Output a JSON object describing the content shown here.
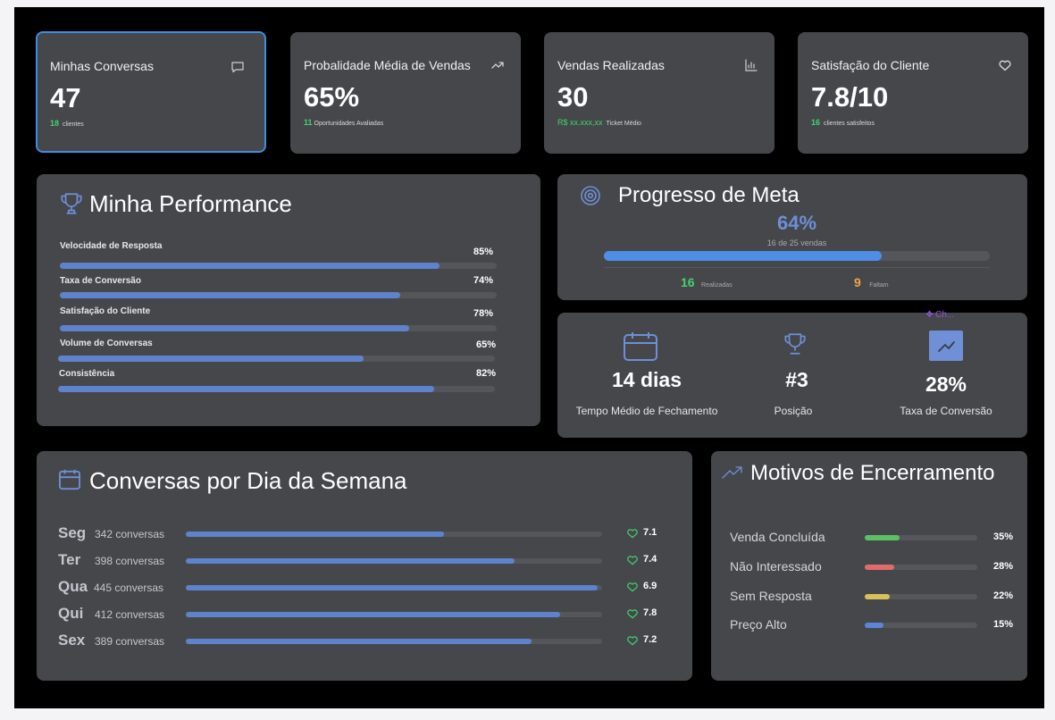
{
  "kpis": [
    {
      "title": "Minhas Conversas",
      "value": "47",
      "highlight": "18",
      "caption": "clientes",
      "icon": "chat-icon"
    },
    {
      "title": "Probalidade Média de Vendas",
      "value": "65%",
      "highlight": "11",
      "caption": "Oportunidades Avaliadas",
      "icon": "trending-up-icon"
    },
    {
      "title": "Vendas Realizadas",
      "value": "30",
      "highlight": "R$ xx.xxx,xx",
      "caption": "Ticket Médio",
      "icon": "bar-chart-icon"
    },
    {
      "title": "Satisfação do Cliente",
      "value": "7.8/10",
      "highlight": "16",
      "caption": "clientes satisfeitos",
      "icon": "heart-icon"
    }
  ],
  "performance": {
    "title": "Minha Performance",
    "items": [
      {
        "label": "Velocidade de Resposta",
        "pct_text": "85%",
        "value": 0.87
      },
      {
        "label": "Taxa de Conversão",
        "pct_text": "74%",
        "value": 0.78
      },
      {
        "label": "Satisfação do Cliente",
        "pct_text": "78%",
        "value": 0.8
      },
      {
        "label": "Volume de Conversas",
        "pct_text": "65%",
        "value": 0.7
      },
      {
        "label": "Consistência",
        "pct_text": "82%",
        "value": 0.86
      }
    ]
  },
  "meta": {
    "title": "Progresso de Meta",
    "percent": "64%",
    "subtitle": "16 de 25 vendas",
    "progress": 0.72,
    "done_value": "16",
    "done_label": "Realizadas",
    "left_value": "9",
    "left_label": "Faltam"
  },
  "stats": {
    "badge": "Ch...",
    "items": [
      {
        "value": "14 dias",
        "label": "Tempo Médio de Fechamento",
        "icon": "calendar-icon"
      },
      {
        "value": "#3",
        "label": "Posição",
        "icon": "trophy-icon"
      },
      {
        "value": "28%",
        "label": "Taxa de Conversão",
        "icon": "chart-line-icon"
      }
    ]
  },
  "weekdays": {
    "title": "Conversas por Dia da Semana",
    "days": [
      {
        "abbr": "Seg",
        "count": "342 conversas",
        "score": "7.1",
        "value": 0.62
      },
      {
        "abbr": "Ter",
        "count": "398 conversas",
        "score": "7.4",
        "value": 0.79
      },
      {
        "abbr": "Qua",
        "count": "445 conversas",
        "score": "6.9",
        "value": 0.99
      },
      {
        "abbr": "Qui",
        "count": "412 conversas",
        "score": "7.8",
        "value": 0.9
      },
      {
        "abbr": "Sex",
        "count": "389 conversas",
        "score": "7.2",
        "value": 0.83
      }
    ]
  },
  "motivos": {
    "title": "Motivos de Encerramento",
    "items": [
      {
        "label": "Venda Concluída",
        "pct": "35%",
        "value": 0.31,
        "color": "#5cc066"
      },
      {
        "label": "Não Interessado",
        "pct": "28%",
        "value": 0.26,
        "color": "#e06b6b"
      },
      {
        "label": "Sem Resposta",
        "pct": "22%",
        "value": 0.22,
        "color": "#d8c05a"
      },
      {
        "label": "Preço Alto",
        "pct": "15%",
        "value": 0.17,
        "color": "#5a86d6"
      }
    ]
  },
  "colors": {
    "accent": "#3a8ee6",
    "bar": "#5e82cc",
    "green": "#44d36b",
    "orange": "#f0a640",
    "card": "#45474b"
  }
}
